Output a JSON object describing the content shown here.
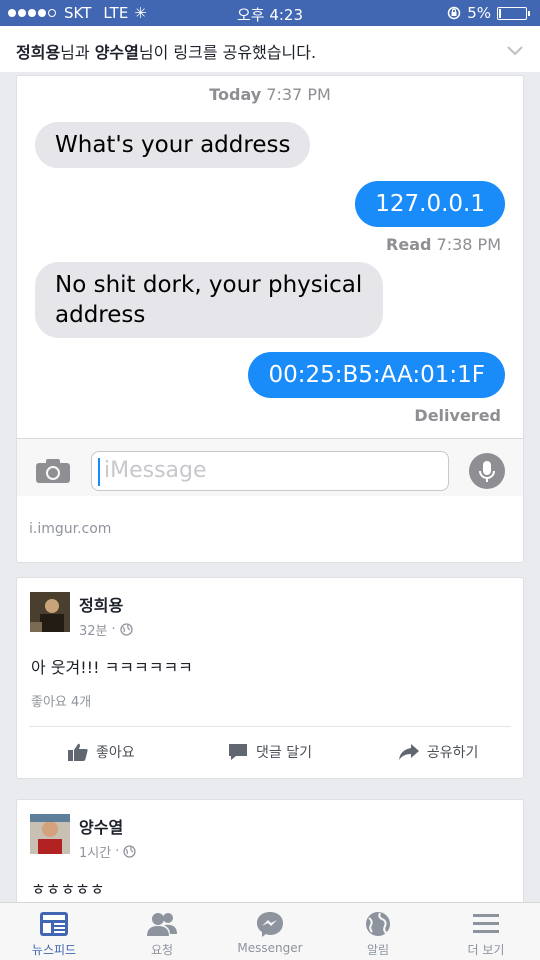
{
  "status_bar": {
    "carrier": "SKT",
    "network": "LTE",
    "time": "오후 4:23",
    "battery": "5%",
    "battery_level": 0.05
  },
  "share_header": {
    "user1": "정희용",
    "mid": "님과 ",
    "user2": "양수열",
    "suffix": "님이 링크를 공유했습니다."
  },
  "link_card": {
    "imessage": {
      "timestamp_day": "Today",
      "timestamp_time": "7:37 PM",
      "messages": [
        {
          "text": "What's your address",
          "direction": "incoming"
        },
        {
          "text": "127.0.0.1",
          "direction": "outgoing"
        },
        {
          "text": "No shit dork, your physical address",
          "direction": "incoming"
        },
        {
          "text": "00:25:B5:AA:01:1F",
          "direction": "outgoing"
        }
      ],
      "read_label": "Read",
      "read_time": "7:38 PM",
      "delivered": "Delivered",
      "input_placeholder": "iMessage"
    },
    "domain": "i.imgur.com"
  },
  "posts": [
    {
      "author": "정희용",
      "time": "32분",
      "text": "아 웃겨!!! ㅋㅋㅋㅋㅋㅋ",
      "likes": "좋아요 4개",
      "actions": {
        "like": "좋아요",
        "comment": "댓글 달기",
        "share": "공유하기"
      }
    },
    {
      "author": "양수열",
      "time": "1시간",
      "text": "ㅎㅎㅎㅎㅎ"
    }
  ],
  "tabbar": {
    "items": [
      {
        "label": "뉴스피드",
        "icon": "news-feed-icon",
        "active": true
      },
      {
        "label": "요청",
        "icon": "friend-requests-icon"
      },
      {
        "label": "Messenger",
        "icon": "messenger-icon"
      },
      {
        "label": "알림",
        "icon": "globe-notifications-icon"
      },
      {
        "label": "더 보기",
        "icon": "menu-icon"
      }
    ]
  },
  "colors": {
    "facebook_blue": "#4267b2",
    "imessage_blue": "#1a8cf9",
    "bubble_gray": "#e5e5ea"
  }
}
